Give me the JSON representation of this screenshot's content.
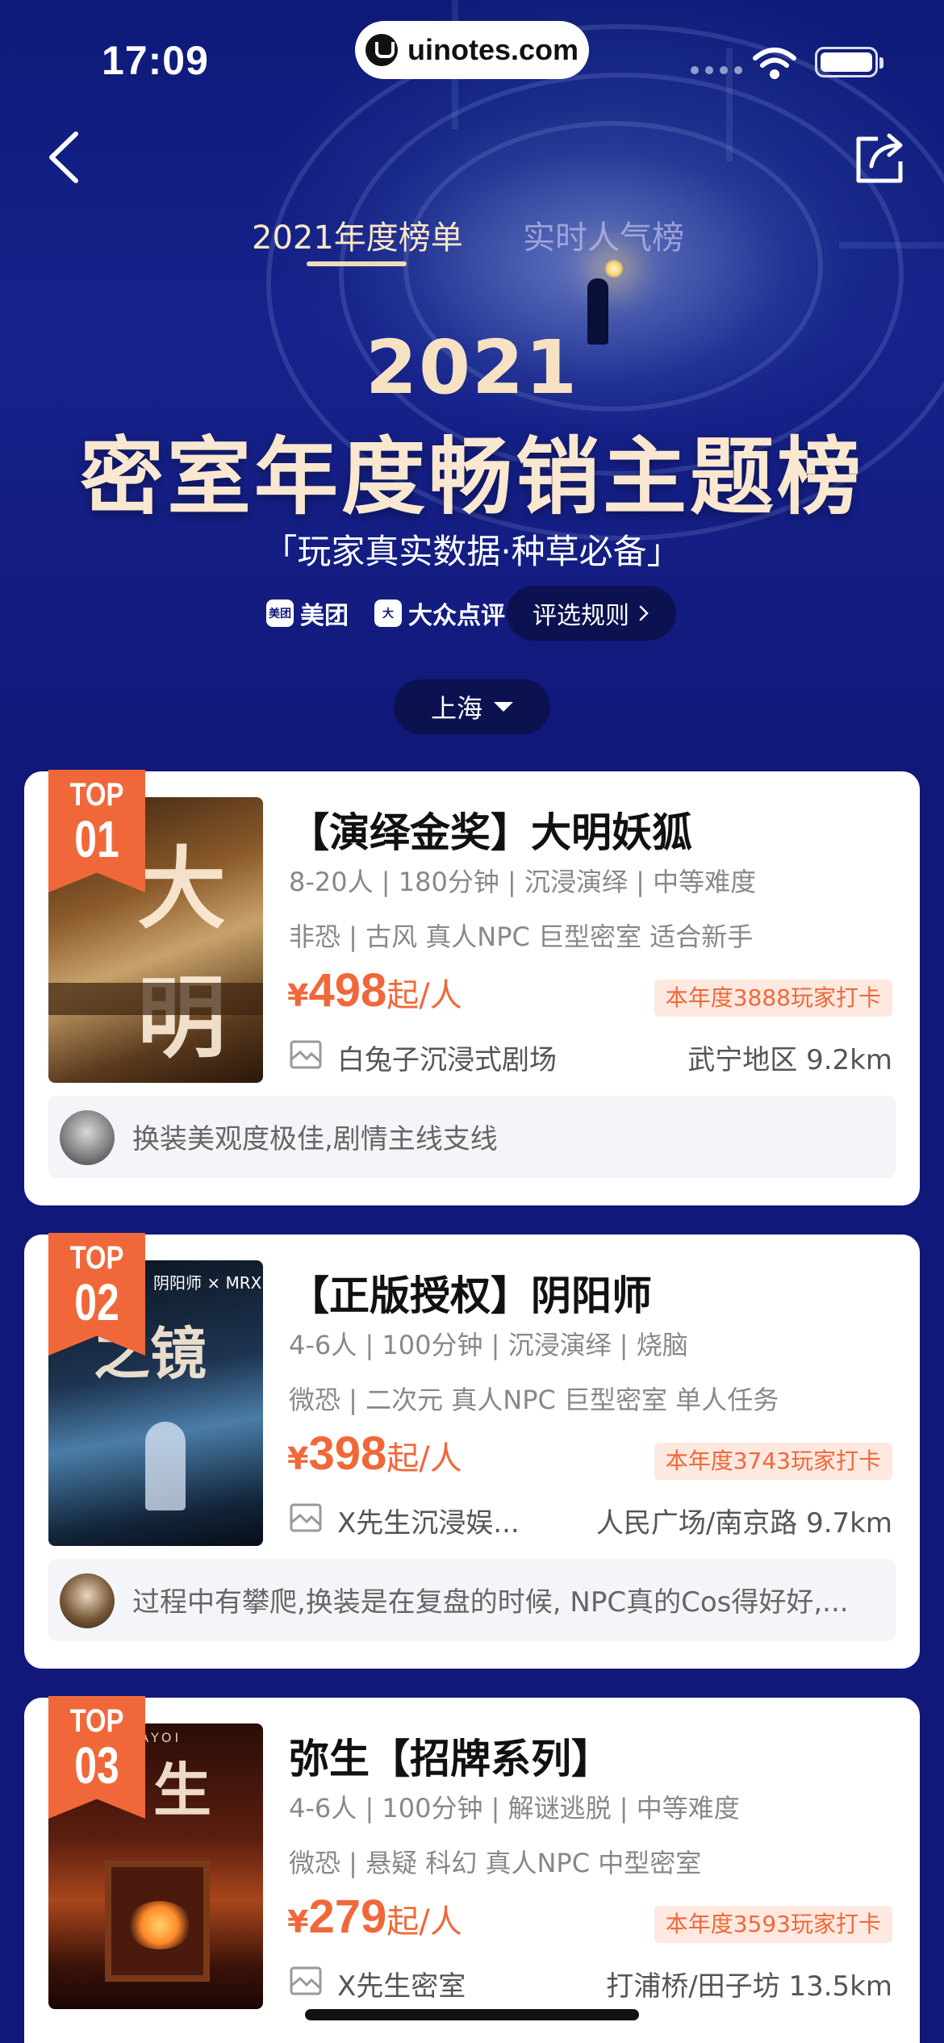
{
  "status_bar": {
    "time": "17:09",
    "url": "uinotes.com"
  },
  "tabs": [
    {
      "label": "2021年度榜单",
      "active": true
    },
    {
      "label": "实时人气榜",
      "active": false
    }
  ],
  "hero": {
    "year": "2021",
    "title": "密室年度畅销主题榜",
    "subtitle": "「玩家真实数据·种草必备」",
    "brands": [
      {
        "icon": "美团",
        "label": "美团"
      },
      {
        "icon": "大",
        "label": "大众点评"
      }
    ],
    "rules_label": "评选规则",
    "city": "上海"
  },
  "colors": {
    "accent": "#f0683a",
    "hero_bg": "#12187a",
    "title_gold": "#f9e8cf"
  },
  "cards": [
    {
      "top_label": "TOP",
      "rank": "01",
      "title": "【演绎金奖】大明妖狐",
      "meta": "8-20人 | 180分钟 | 沉浸演绎 | 中等难度",
      "tags": "非恐 | 古风 真人NPC 巨型密室 适合新手",
      "price_symbol": "¥",
      "price": "498",
      "price_unit": "起/人",
      "badge": "本年度3888玩家打卡",
      "venue": "白兔子沉浸式剧场",
      "location": "武宁地区 9.2km",
      "review": "换装美观度极佳,剧情主线支线"
    },
    {
      "top_label": "TOP",
      "rank": "02",
      "title": "【正版授权】阴阳师",
      "meta": "4-6人 | 100分钟 | 沉浸演绎 | 烧脑",
      "tags": "微恐 | 二次元 真人NPC 巨型密室 单人任务",
      "price_symbol": "¥",
      "price": "398",
      "price_unit": "起/人",
      "badge": "本年度3743玩家打卡",
      "venue": "X先生沉浸娱...",
      "location": "人民广场/南京路 9.7km",
      "review": "过程中有攀爬,换装是在复盘的时候, NPC真的Cos得好好,..."
    },
    {
      "top_label": "TOP",
      "rank": "03",
      "title": "弥生【招牌系列】",
      "meta": "4-6人 | 100分钟 | 解谜逃脱 | 中等难度",
      "tags": "微恐 | 悬疑 科幻 真人NPC 中型密室",
      "price_symbol": "¥",
      "price": "279",
      "price_unit": "起/人",
      "badge": "本年度3593玩家打卡",
      "venue": "X先生密室",
      "location": "打浦桥/田子坊 13.5km"
    }
  ],
  "posters": {
    "p1": "大明妖狐",
    "p2_brand": "阴阳师 × MRX",
    "p2_glyph": "之镜",
    "p3_header": "YAYOI",
    "p3_glyph": "生"
  }
}
